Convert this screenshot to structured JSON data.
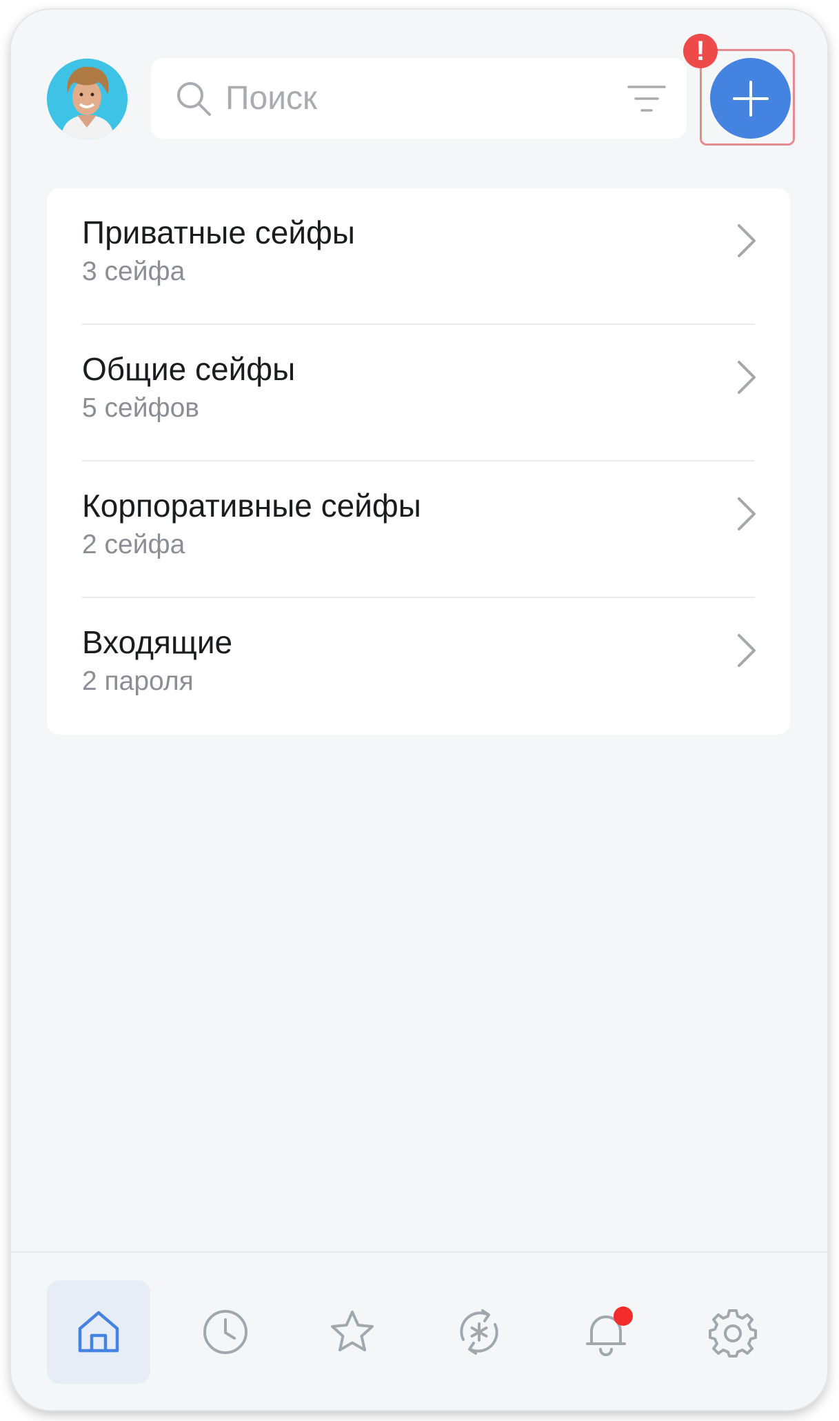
{
  "colors": {
    "accent": "#4583e0",
    "alert": "#ef4a4a",
    "notification_dot": "#f22b2b",
    "background": "#f5f6f8",
    "card": "#ffffff"
  },
  "header": {
    "avatar_icon": "user-avatar",
    "search": {
      "placeholder": "Поиск",
      "icon": "search-icon",
      "filter_icon": "filter-icon"
    },
    "add_button": {
      "icon": "plus-icon",
      "alert_badge": "!"
    }
  },
  "vaults": {
    "items": [
      {
        "title": "Приватные сейфы",
        "subtitle": "3 сейфа"
      },
      {
        "title": "Общие сейфы",
        "subtitle": "5 сейфов"
      },
      {
        "title": "Корпоративные сейфы",
        "subtitle": "2 сейфа"
      },
      {
        "title": "Входящие",
        "subtitle": "2 пароля"
      }
    ]
  },
  "bottom_nav": {
    "items": [
      {
        "icon": "home-icon",
        "active": true
      },
      {
        "icon": "clock-icon",
        "active": false
      },
      {
        "icon": "star-icon",
        "active": false
      },
      {
        "icon": "password-generator-icon",
        "active": false
      },
      {
        "icon": "bell-icon",
        "active": false,
        "has_notification": true
      },
      {
        "icon": "gear-icon",
        "active": false
      }
    ]
  }
}
